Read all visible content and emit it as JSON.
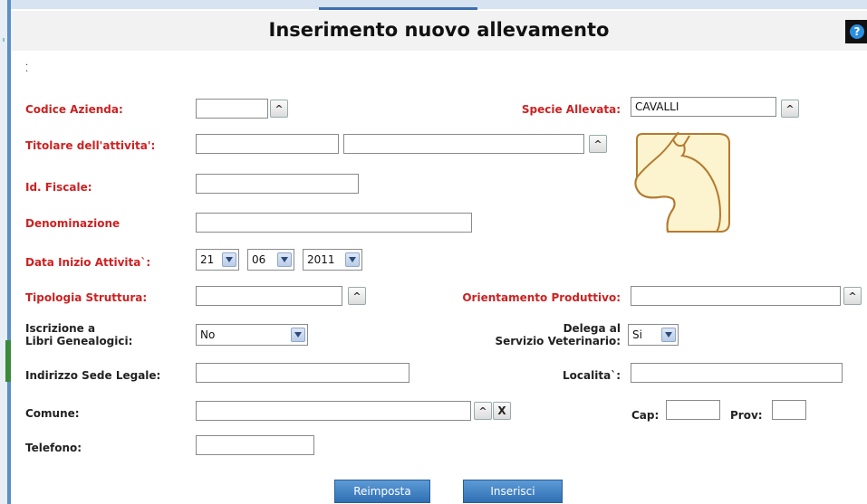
{
  "page": {
    "title": "Inserimento nuovo allevamento",
    "help_icon": "question-mark-icon",
    "help_glyph": "?"
  },
  "form": {
    "codice_azienda": {
      "label": "Codice Azienda:",
      "value": ""
    },
    "specie_allevata": {
      "label": "Specie Allevata:",
      "value": "CAVALLI",
      "icon": "horse-head-icon"
    },
    "titolare": {
      "label": "Titolare dell'attivita':",
      "value1": "",
      "value2": ""
    },
    "id_fiscale": {
      "label": "Id. Fiscale:",
      "value": ""
    },
    "denominazione": {
      "label": "Denominazione",
      "value": ""
    },
    "data_inizio": {
      "label": "Data Inizio Attivita`:",
      "day": "21",
      "month": "06",
      "year": "2011"
    },
    "tipologia_struttura": {
      "label": "Tipologia Struttura:",
      "value": ""
    },
    "orientamento_produttivo": {
      "label": "Orientamento Produttivo:",
      "value": ""
    },
    "iscrizione": {
      "label_line1": "Iscrizione a",
      "label_line2": "Libri Genealogici:",
      "value": "No"
    },
    "delega": {
      "label_line1": "Delega al",
      "label_line2": "Servizio Veterinario:",
      "value": "Si"
    },
    "indirizzo": {
      "label": "Indirizzo Sede Legale:",
      "value": ""
    },
    "localita": {
      "label": "Localita`:",
      "value": ""
    },
    "comune": {
      "label": "Comune:",
      "value": "",
      "clear_glyph": "X"
    },
    "cap": {
      "label": "Cap:",
      "value": ""
    },
    "prov": {
      "label": "Prov:",
      "value": ""
    },
    "telefono": {
      "label": "Telefono:",
      "value": ""
    }
  },
  "buttons": {
    "reset": "Reimposta",
    "submit": "Inserisci"
  },
  "colors": {
    "required_label": "#cc2222",
    "button": "#3b7fc4",
    "accent_bar": "#5b8fc7"
  }
}
